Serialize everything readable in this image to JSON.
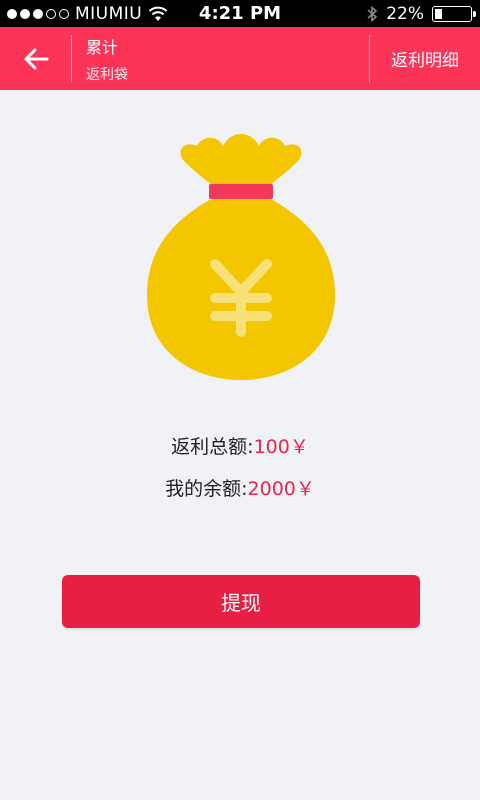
{
  "status_bar": {
    "carrier": "MIUMIU",
    "time": "4:21 PM",
    "battery_text": "22%",
    "battery_level": 0.22,
    "signal_dots_filled": 3,
    "signal_dots_total": 5
  },
  "header": {
    "title": "累计",
    "subtitle": "返利袋",
    "right_link": "返利明细",
    "background_color": "#fb3458"
  },
  "stats": {
    "total_rebate_label": "返利总额:",
    "total_rebate_value": "100￥",
    "balance_label": "我的余额:",
    "balance_value": "2000￥",
    "value_color": "#e8264a"
  },
  "actions": {
    "withdraw_label": "提现",
    "withdraw_color": "#e81f45"
  },
  "icons": {
    "back": "arrow-left-icon",
    "wifi": "wifi-icon",
    "bluetooth": "bluetooth-icon",
    "battery": "battery-icon",
    "money_bag": "money-bag-icon"
  }
}
